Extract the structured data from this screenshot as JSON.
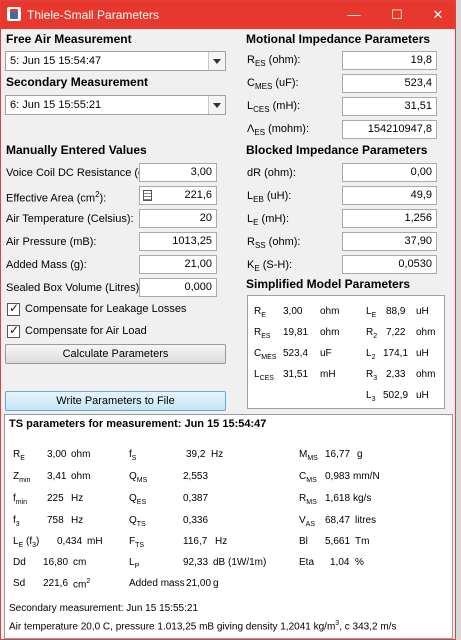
{
  "window": {
    "title": "Thiele-Small Parameters",
    "minimize": "—",
    "maximize": "☐",
    "close": "✕"
  },
  "free_air": {
    "heading": "Free Air Measurement",
    "selected": "5: Jun 15 15:54:47"
  },
  "secondary": {
    "heading": "Secondary Measurement",
    "selected": "6: Jun 15 15:55:21"
  },
  "manual": {
    "heading": "Manually Entered Values",
    "voice_coil": {
      "label": "Voice Coil DC Resistance (ohm):",
      "value": "3,00"
    },
    "eff_area": {
      "label_main": "Effective Area (cm",
      "label_sup": "2",
      "label_end": "):",
      "value": "221,6"
    },
    "air_temp": {
      "label": "Air Temperature (Celsius):",
      "value": "20"
    },
    "air_pressure": {
      "label": "Air Pressure (mB):",
      "value": "1013,25"
    },
    "added_mass": {
      "label": "Added Mass (g):",
      "value": "21,00"
    },
    "sealed_box": {
      "label": "Sealed Box Volume (Litres):",
      "value": "0,000"
    },
    "leakage": {
      "label": "Compensate for Leakage Losses",
      "checked": true
    },
    "air_load": {
      "label": "Compensate for Air Load",
      "checked": true
    },
    "calc_button": "Calculate Parameters",
    "write_button": "Write Parameters to File"
  },
  "motional": {
    "heading": "Motional Impedance Parameters",
    "res": {
      "sym": "R",
      "sub": "ES",
      "unit": " (ohm):",
      "value": "19,8"
    },
    "cmes": {
      "sym": "C",
      "sub": "MES",
      "unit": " (uF):",
      "value": "523,4"
    },
    "lces": {
      "sym": "L",
      "sub": "CES",
      "unit": " (mH):",
      "value": "31,51"
    },
    "aes": {
      "sym": "Λ",
      "sub": "ES",
      "unit": " (mohm):",
      "value": "154210947,8"
    }
  },
  "blocked": {
    "heading": "Blocked Impedance Parameters",
    "dr": {
      "label": "dR (ohm):",
      "value": "0,00"
    },
    "leb": {
      "sym": "L",
      "sub": "EB",
      "unit": " (uH):",
      "value": "49,9"
    },
    "le": {
      "sym": "L",
      "sub": "E",
      "unit": " (mH):",
      "value": "1,256"
    },
    "rss": {
      "sym": "R",
      "sub": "SS",
      "unit": " (ohm):",
      "value": "37,90"
    },
    "ke": {
      "sym": "K",
      "sub": "E",
      "unit": " (S-H):",
      "value": "0,0530"
    }
  },
  "simplified": {
    "heading": "Simplified Model Parameters",
    "left": [
      {
        "sym": "R",
        "sub": "E",
        "value": "3,00",
        "unit": "ohm"
      },
      {
        "sym": "R",
        "sub": "ES",
        "value": "19,81",
        "unit": "ohm"
      },
      {
        "sym": "C",
        "sub": "MES",
        "value": "523,4",
        "unit": "uF"
      },
      {
        "sym": "L",
        "sub": "CES",
        "value": "31,51",
        "unit": "mH"
      }
    ],
    "right": [
      {
        "sym": "L",
        "sub": "E",
        "value": "88,9",
        "unit": "uH"
      },
      {
        "sym": "R",
        "sub": "2",
        "value": "7,22",
        "unit": "ohm"
      },
      {
        "sym": "L",
        "sub": "2",
        "value": "174,1",
        "unit": "uH"
      },
      {
        "sym": "R",
        "sub": "3",
        "value": "2,33",
        "unit": "ohm"
      },
      {
        "sym": "L",
        "sub": "3",
        "value": "502,9",
        "unit": "uH"
      }
    ]
  },
  "ts": {
    "heading": "TS parameters for measurement: Jun 15 15:54:47",
    "col1": [
      {
        "sym": "R",
        "sub": "E",
        "value": "3,00",
        "unit": "ohm"
      },
      {
        "sym": "Z",
        "sub": "min",
        "value": "3,41",
        "unit": "ohm"
      },
      {
        "sym": "f",
        "sub": "min",
        "value": "225",
        "unit": "Hz"
      },
      {
        "sym": "f",
        "sub": "3",
        "value": "758",
        "unit": "Hz"
      },
      {
        "sym": "L",
        "sub": "E",
        "extra": " (f",
        "extra_sub": "3",
        "extra_end": ")",
        "value": "0,434",
        "unit": "mH"
      },
      {
        "sym": "Dd",
        "sub": "",
        "value": "16,80",
        "unit": "cm"
      },
      {
        "sym": "Sd",
        "sub": "",
        "value": "221,6",
        "unit": "cm",
        "unit_sup": "2"
      }
    ],
    "col2": [
      {
        "sym": "f",
        "sub": "S",
        "value": "39,2",
        "unit": "Hz"
      },
      {
        "sym": "Q",
        "sub": "MS",
        "value": "2,553",
        "unit": ""
      },
      {
        "sym": "Q",
        "sub": "ES",
        "value": "0,387",
        "unit": ""
      },
      {
        "sym": "Q",
        "sub": "TS",
        "value": "0,336",
        "unit": ""
      },
      {
        "sym": "F",
        "sub": "TS",
        "value": "116,7",
        "unit": "Hz"
      },
      {
        "sym": "L",
        "sub": "P",
        "value": "92,33",
        "unit": "dB (1W/1m)"
      },
      {
        "sym": "Added mass",
        "sub": "",
        "value": "21,00",
        "unit": "g"
      }
    ],
    "col3": [
      {
        "sym": "M",
        "sub": "MS",
        "value": "16,77",
        "unit": "g"
      },
      {
        "sym": "C",
        "sub": "MS",
        "value": "0,983",
        "unit": "mm/N"
      },
      {
        "sym": "R",
        "sub": "MS",
        "value": "1,618",
        "unit": "kg/s"
      },
      {
        "sym": "V",
        "sub": "AS",
        "value": "68,47",
        "unit": "litres"
      },
      {
        "sym": "Bl",
        "sub": "",
        "value": "5,661",
        "unit": "Tm"
      },
      {
        "sym": "Eta",
        "sub": "",
        "value": "1,04",
        "unit": "%"
      }
    ],
    "footer1": "Secondary measurement: Jun 15 15:55:21",
    "footer2_a": "Air temperature 20,0 C, pressure 1.013,25 mB giving density 1,2041 kg/m",
    "footer2_sup": "3",
    "footer2_b": ", c 343,2 m/s"
  },
  "colors": {
    "titlebar": "#e8372c",
    "window_bg": "#f0f0f0",
    "active_button": "#c6e6f6"
  }
}
